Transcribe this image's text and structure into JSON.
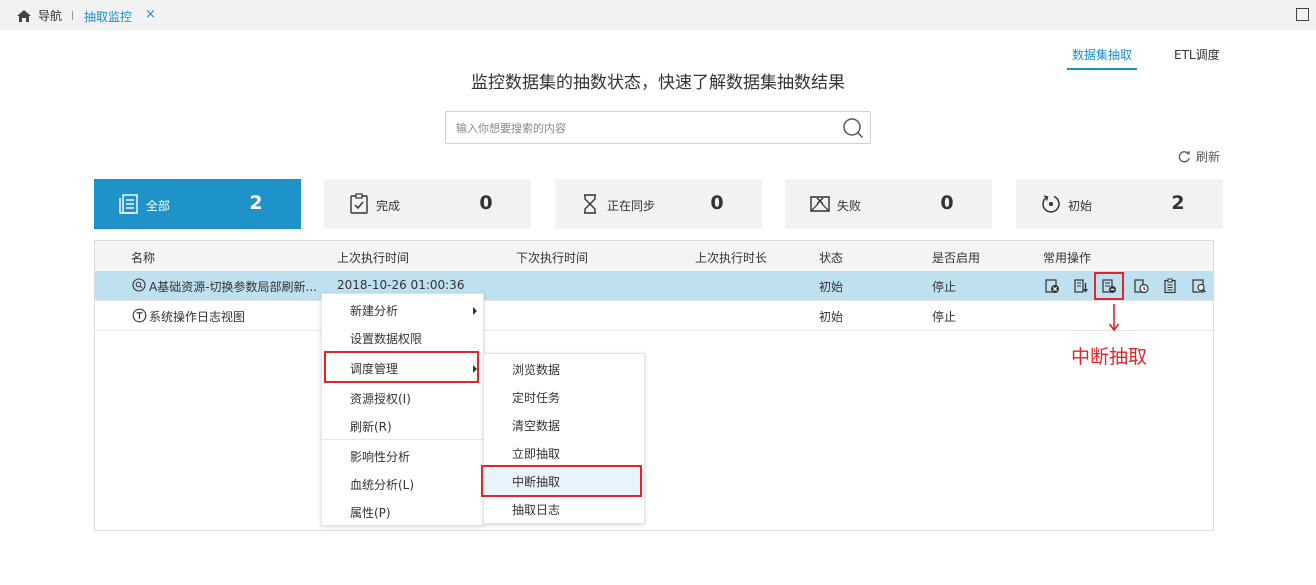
{
  "topbar": {
    "home_label": "导航",
    "tab_label": "抽取监控",
    "tab_close": "×"
  },
  "mode_tabs": [
    {
      "label": "数据集抽取",
      "active": true
    },
    {
      "label": "ETL调度",
      "active": false
    }
  ],
  "headline": "监控数据集的抽数状态，快速了解数据集抽数结果",
  "search": {
    "placeholder": "输入你想要搜索的内容",
    "value": ""
  },
  "refresh_label": "刷新",
  "status_cards": [
    {
      "label": "全部",
      "count": "2",
      "icon": "list-icon",
      "active": true
    },
    {
      "label": "完成",
      "count": "0",
      "icon": "check-clipboard-icon",
      "active": false
    },
    {
      "label": "正在同步",
      "count": "0",
      "icon": "hourglass-icon",
      "active": false
    },
    {
      "label": "失败",
      "count": "0",
      "icon": "failed-envelope-icon",
      "active": false
    },
    {
      "label": "初始",
      "count": "2",
      "icon": "reset-circle-icon",
      "active": false
    }
  ],
  "table": {
    "headers": [
      "名称",
      "上次执行时间",
      "下次执行时间",
      "上次执行时长",
      "状态",
      "是否启用",
      "常用操作"
    ],
    "rows": [
      {
        "name": "A基础资源-切换参数局部刷新...",
        "icon": "dataset-search-icon",
        "last_run": "2018-10-26 01:00:36",
        "next_run": "",
        "duration": "",
        "status": "初始",
        "enabled": "停止",
        "selected": true
      },
      {
        "name": "系统操作日志视图",
        "icon": "view-t-icon",
        "last_run": "",
        "next_run": "",
        "duration": "",
        "status": "初始",
        "enabled": "停止",
        "selected": false
      }
    ]
  },
  "row_operations": [
    "clear-data-icon",
    "extract-now-icon",
    "interrupt-extract-icon",
    "timed-task-icon",
    "extract-log-icon",
    "browse-data-icon"
  ],
  "context_menu": {
    "items": [
      {
        "label": "新建分析",
        "has_sub": true
      },
      {
        "label": "设置数据权限",
        "has_sub": false
      },
      {
        "label": "调度管理",
        "has_sub": true
      },
      {
        "label": "资源授权(I)",
        "has_sub": false
      },
      {
        "label": "刷新(R)",
        "has_sub": false
      },
      {
        "label": "影响性分析",
        "has_sub": false
      },
      {
        "label": "血统分析(L)",
        "has_sub": false
      },
      {
        "label": "属性(P)",
        "has_sub": false
      }
    ]
  },
  "submenu": {
    "items": [
      "浏览数据",
      "定时任务",
      "清空数据",
      "立即抽取",
      "中断抽取",
      "抽取日志"
    ]
  },
  "annotation": {
    "text": "中断抽取",
    "color": "#e0262a"
  },
  "colors": {
    "accent": "#1e93c9",
    "link": "#1b8dd1",
    "highlight": "#e0262a",
    "selected_row": "#bfe1ef"
  }
}
